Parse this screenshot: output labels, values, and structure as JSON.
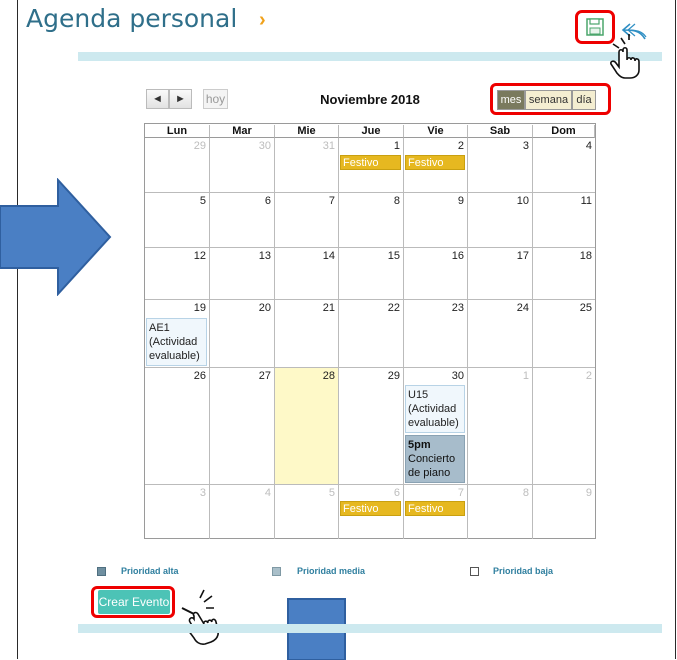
{
  "header": {
    "title": "Agenda personal",
    "chevron": "›"
  },
  "icons": {
    "save": "save-icon",
    "undo": "undo-icon",
    "pointer": "hand-pointer-icon"
  },
  "nav": {
    "prev": "◄",
    "next": "►",
    "today": "hoy"
  },
  "calendar": {
    "month_title": "Noviembre 2018",
    "views": [
      {
        "label": "mes",
        "active": true
      },
      {
        "label": "semana",
        "active": false
      },
      {
        "label": "día",
        "active": false
      }
    ],
    "weekdays": [
      "Lun",
      "Mar",
      "Mie",
      "Jue",
      "Vie",
      "Sab",
      "Dom"
    ],
    "weeks": [
      [
        {
          "d": "29",
          "other": true
        },
        {
          "d": "30",
          "other": true
        },
        {
          "d": "31",
          "other": true
        },
        {
          "d": "1"
        },
        {
          "d": "2"
        },
        {
          "d": "3"
        },
        {
          "d": "4"
        }
      ],
      [
        {
          "d": "5"
        },
        {
          "d": "6"
        },
        {
          "d": "7"
        },
        {
          "d": "8"
        },
        {
          "d": "9"
        },
        {
          "d": "10"
        },
        {
          "d": "11"
        }
      ],
      [
        {
          "d": "12"
        },
        {
          "d": "13"
        },
        {
          "d": "14"
        },
        {
          "d": "15"
        },
        {
          "d": "16"
        },
        {
          "d": "17"
        },
        {
          "d": "18"
        }
      ],
      [
        {
          "d": "19"
        },
        {
          "d": "20"
        },
        {
          "d": "21"
        },
        {
          "d": "22"
        },
        {
          "d": "23"
        },
        {
          "d": "24"
        },
        {
          "d": "25"
        }
      ],
      [
        {
          "d": "26"
        },
        {
          "d": "27"
        },
        {
          "d": "28",
          "today": true
        },
        {
          "d": "29"
        },
        {
          "d": "30"
        },
        {
          "d": "1",
          "other": true
        },
        {
          "d": "2",
          "other": true
        }
      ],
      [
        {
          "d": "3",
          "other": true
        },
        {
          "d": "4",
          "other": true
        },
        {
          "d": "5",
          "other": true
        },
        {
          "d": "6",
          "other": true
        },
        {
          "d": "7",
          "other": true
        },
        {
          "d": "8",
          "other": true
        },
        {
          "d": "9",
          "other": true
        }
      ]
    ],
    "events": {
      "festivo": "Festivo",
      "ae1": "AE1 (Actividad evaluable)",
      "u15": "U15 (Actividad evaluable)",
      "concierto_time": "5pm",
      "concierto_title": "Concierto de piano"
    }
  },
  "legend": {
    "alta": "Prioridad alta",
    "media": "Prioridad media",
    "baja": "Prioridad baja"
  },
  "actions": {
    "create_event": "Crear Evento"
  },
  "colors": {
    "accent": "#2f6f8a",
    "festivo": "#e6b820",
    "today": "#fef9c8",
    "create_button": "#4cc3b6",
    "highlight": "#e00000",
    "arrow": "#4a7fc4"
  }
}
